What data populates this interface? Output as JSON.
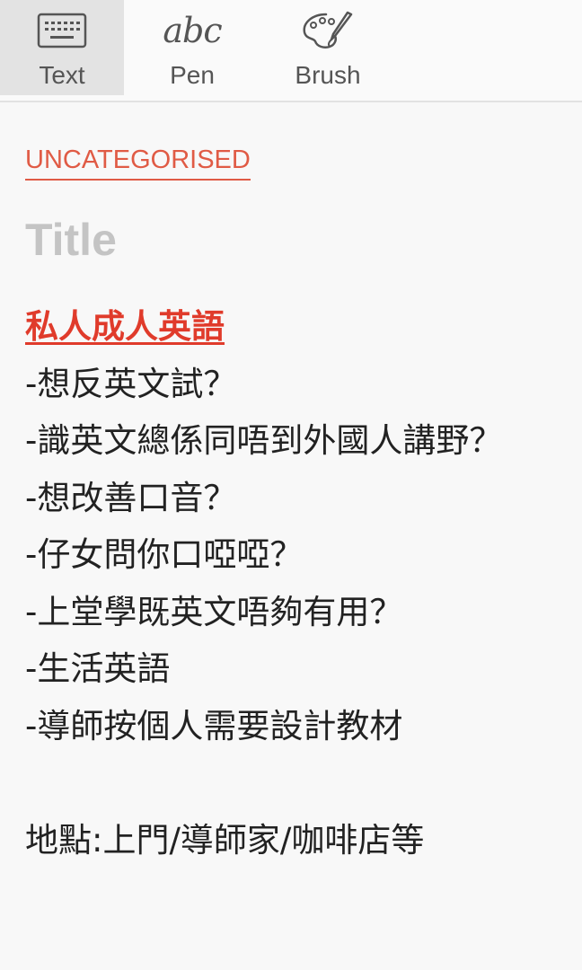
{
  "toolbar": {
    "tools": [
      {
        "label": "Text",
        "icon": "keyboard-icon",
        "active": true
      },
      {
        "label": "Pen",
        "icon": "abc-handwriting-icon",
        "icon_text": "abc",
        "active": false
      },
      {
        "label": "Brush",
        "icon": "palette-brush-icon",
        "active": false
      }
    ]
  },
  "note": {
    "category": "UNCATEGORISED",
    "title_placeholder": "Title",
    "headline": "私人成人英語",
    "lines": [
      "-想反英文試？",
      "-識英文總係同唔到外國人講野？",
      "-想改善口音？",
      "-仔女問你口啞啞？",
      "-上堂學既英文唔夠有用？",
      "-生活英語",
      "-導師按個人需要設計教材"
    ],
    "location": "地點:上門/導師家/咖啡店等"
  },
  "colors": {
    "accent": "#e05b45",
    "headline": "#e03b2b",
    "placeholder": "#c4c4c4"
  }
}
